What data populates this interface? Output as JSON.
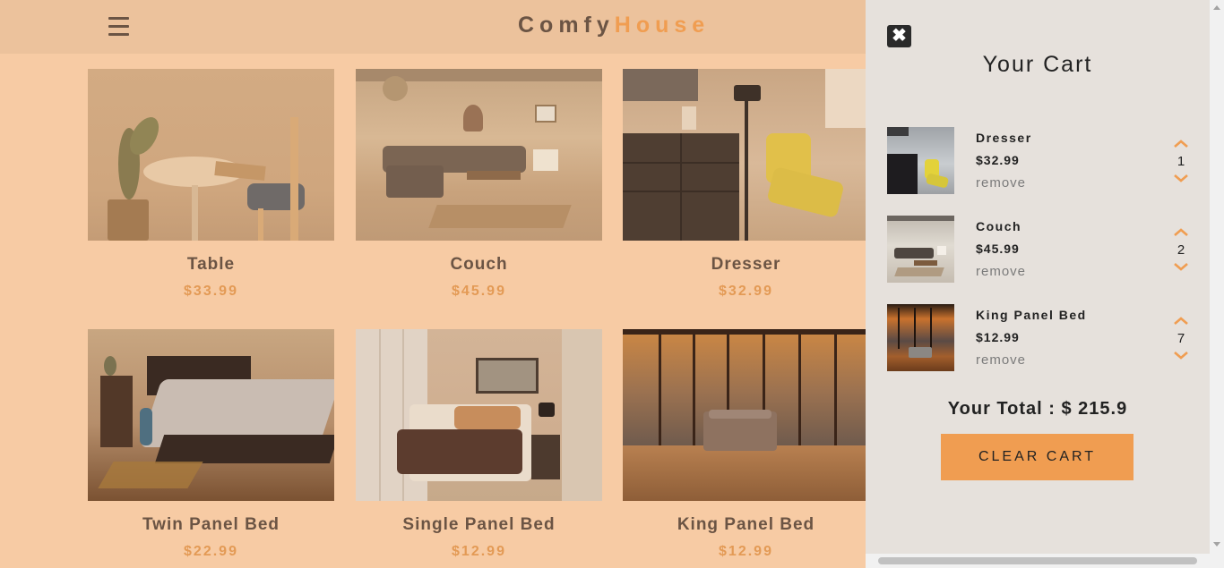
{
  "navbar": {
    "menu_icon": "hamburger-icon",
    "logo_part1": "Comfy",
    "logo_part2": "House",
    "colors": {
      "accent": "#f09d51",
      "text": "#6b5444",
      "bar": "#ecc29c"
    }
  },
  "products": [
    {
      "title": "Table",
      "price": "$33.99"
    },
    {
      "title": "Couch",
      "price": "$45.99"
    },
    {
      "title": "Dresser",
      "price": "$32.99"
    },
    {
      "title": "Twin Panel Bed",
      "price": "$22.99"
    },
    {
      "title": "Single Panel Bed",
      "price": "$12.99"
    },
    {
      "title": "King Panel Bed",
      "price": "$12.99"
    }
  ],
  "cart": {
    "close_icon": "close-icon",
    "title": "Your Cart",
    "items": [
      {
        "name": "Dresser",
        "price": "$32.99",
        "remove_label": "remove",
        "quantity": "1"
      },
      {
        "name": "Couch",
        "price": "$45.99",
        "remove_label": "remove",
        "quantity": "2"
      },
      {
        "name": "King Panel Bed",
        "price": "$12.99",
        "remove_label": "remove",
        "quantity": "7"
      }
    ],
    "total_label": "Your Total : $ 215.9",
    "clear_label": "CLEAR CART"
  }
}
